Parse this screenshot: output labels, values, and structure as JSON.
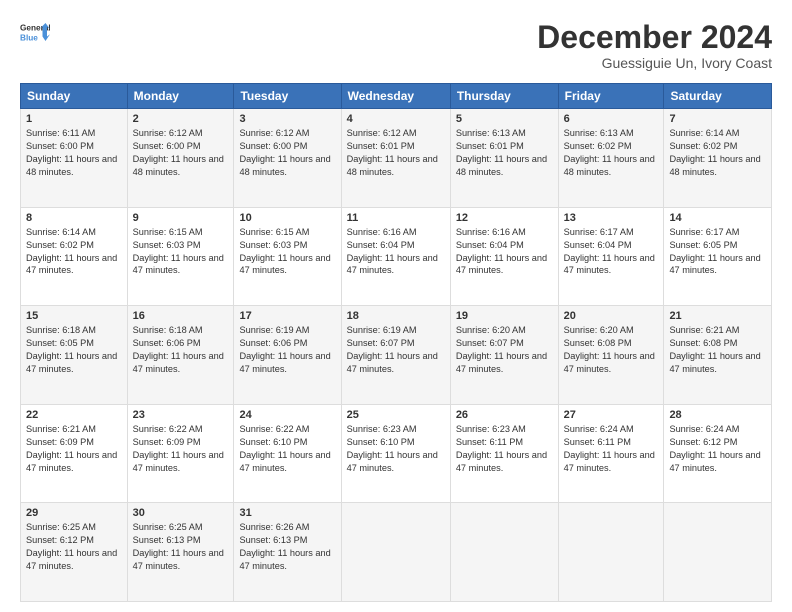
{
  "logo": {
    "line1": "General",
    "line2": "Blue"
  },
  "title": "December 2024",
  "location": "Guessiguie Un, Ivory Coast",
  "days_of_week": [
    "Sunday",
    "Monday",
    "Tuesday",
    "Wednesday",
    "Thursday",
    "Friday",
    "Saturday"
  ],
  "weeks": [
    [
      {
        "day": "1",
        "sunrise": "6:11 AM",
        "sunset": "6:00 PM",
        "daylight": "11 hours and 48 minutes."
      },
      {
        "day": "2",
        "sunrise": "6:12 AM",
        "sunset": "6:00 PM",
        "daylight": "11 hours and 48 minutes."
      },
      {
        "day": "3",
        "sunrise": "6:12 AM",
        "sunset": "6:00 PM",
        "daylight": "11 hours and 48 minutes."
      },
      {
        "day": "4",
        "sunrise": "6:12 AM",
        "sunset": "6:01 PM",
        "daylight": "11 hours and 48 minutes."
      },
      {
        "day": "5",
        "sunrise": "6:13 AM",
        "sunset": "6:01 PM",
        "daylight": "11 hours and 48 minutes."
      },
      {
        "day": "6",
        "sunrise": "6:13 AM",
        "sunset": "6:02 PM",
        "daylight": "11 hours and 48 minutes."
      },
      {
        "day": "7",
        "sunrise": "6:14 AM",
        "sunset": "6:02 PM",
        "daylight": "11 hours and 48 minutes."
      }
    ],
    [
      {
        "day": "8",
        "sunrise": "6:14 AM",
        "sunset": "6:02 PM",
        "daylight": "11 hours and 47 minutes."
      },
      {
        "day": "9",
        "sunrise": "6:15 AM",
        "sunset": "6:03 PM",
        "daylight": "11 hours and 47 minutes."
      },
      {
        "day": "10",
        "sunrise": "6:15 AM",
        "sunset": "6:03 PM",
        "daylight": "11 hours and 47 minutes."
      },
      {
        "day": "11",
        "sunrise": "6:16 AM",
        "sunset": "6:04 PM",
        "daylight": "11 hours and 47 minutes."
      },
      {
        "day": "12",
        "sunrise": "6:16 AM",
        "sunset": "6:04 PM",
        "daylight": "11 hours and 47 minutes."
      },
      {
        "day": "13",
        "sunrise": "6:17 AM",
        "sunset": "6:04 PM",
        "daylight": "11 hours and 47 minutes."
      },
      {
        "day": "14",
        "sunrise": "6:17 AM",
        "sunset": "6:05 PM",
        "daylight": "11 hours and 47 minutes."
      }
    ],
    [
      {
        "day": "15",
        "sunrise": "6:18 AM",
        "sunset": "6:05 PM",
        "daylight": "11 hours and 47 minutes."
      },
      {
        "day": "16",
        "sunrise": "6:18 AM",
        "sunset": "6:06 PM",
        "daylight": "11 hours and 47 minutes."
      },
      {
        "day": "17",
        "sunrise": "6:19 AM",
        "sunset": "6:06 PM",
        "daylight": "11 hours and 47 minutes."
      },
      {
        "day": "18",
        "sunrise": "6:19 AM",
        "sunset": "6:07 PM",
        "daylight": "11 hours and 47 minutes."
      },
      {
        "day": "19",
        "sunrise": "6:20 AM",
        "sunset": "6:07 PM",
        "daylight": "11 hours and 47 minutes."
      },
      {
        "day": "20",
        "sunrise": "6:20 AM",
        "sunset": "6:08 PM",
        "daylight": "11 hours and 47 minutes."
      },
      {
        "day": "21",
        "sunrise": "6:21 AM",
        "sunset": "6:08 PM",
        "daylight": "11 hours and 47 minutes."
      }
    ],
    [
      {
        "day": "22",
        "sunrise": "6:21 AM",
        "sunset": "6:09 PM",
        "daylight": "11 hours and 47 minutes."
      },
      {
        "day": "23",
        "sunrise": "6:22 AM",
        "sunset": "6:09 PM",
        "daylight": "11 hours and 47 minutes."
      },
      {
        "day": "24",
        "sunrise": "6:22 AM",
        "sunset": "6:10 PM",
        "daylight": "11 hours and 47 minutes."
      },
      {
        "day": "25",
        "sunrise": "6:23 AM",
        "sunset": "6:10 PM",
        "daylight": "11 hours and 47 minutes."
      },
      {
        "day": "26",
        "sunrise": "6:23 AM",
        "sunset": "6:11 PM",
        "daylight": "11 hours and 47 minutes."
      },
      {
        "day": "27",
        "sunrise": "6:24 AM",
        "sunset": "6:11 PM",
        "daylight": "11 hours and 47 minutes."
      },
      {
        "day": "28",
        "sunrise": "6:24 AM",
        "sunset": "6:12 PM",
        "daylight": "11 hours and 47 minutes."
      }
    ],
    [
      {
        "day": "29",
        "sunrise": "6:25 AM",
        "sunset": "6:12 PM",
        "daylight": "11 hours and 47 minutes."
      },
      {
        "day": "30",
        "sunrise": "6:25 AM",
        "sunset": "6:13 PM",
        "daylight": "11 hours and 47 minutes."
      },
      {
        "day": "31",
        "sunrise": "6:26 AM",
        "sunset": "6:13 PM",
        "daylight": "11 hours and 47 minutes."
      },
      null,
      null,
      null,
      null
    ]
  ]
}
